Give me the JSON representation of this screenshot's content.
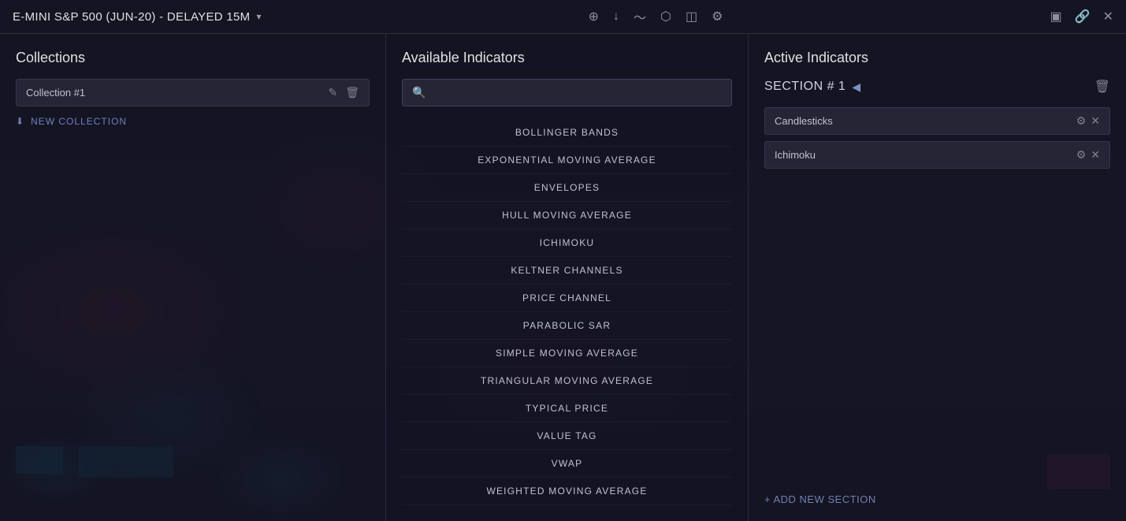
{
  "titleBar": {
    "title": "E-MINI S&P 500 (JUN-20) - DELAYED 15M",
    "dropdownIcon": "▾",
    "icons": [
      "⊕",
      "⬇",
      "〜",
      "⬡",
      "📅",
      "⚙"
    ],
    "actions": [
      "▣",
      "🔗",
      "✕"
    ]
  },
  "collections": {
    "title": "Collections",
    "item": {
      "name": "Collection #1",
      "editIcon": "✎",
      "deleteIcon": "🗑"
    },
    "newCollectionLabel": "NEW COLLECTION",
    "newCollectionIcon": "⬇"
  },
  "availableIndicators": {
    "title": "Available Indicators",
    "searchPlaceholder": "",
    "searchIcon": "🔍",
    "items": [
      "BOLLINGER BANDS",
      "EXPONENTIAL MOVING AVERAGE",
      "ENVELOPES",
      "HULL MOVING AVERAGE",
      "ICHIMOKU",
      "KELTNER CHANNELS",
      "PRICE CHANNEL",
      "PARABOLIC SAR",
      "SIMPLE MOVING AVERAGE",
      "TRIANGULAR MOVING AVERAGE",
      "TYPICAL PRICE",
      "VALUE TAG",
      "VWAP",
      "WEIGHTED MOVING AVERAGE"
    ]
  },
  "activeIndicators": {
    "title": "Active Indicators",
    "sectionTitle": "SECTION # 1",
    "sectionArrow": "◀",
    "deleteSectionIcon": "🗑",
    "items": [
      {
        "name": "Candlesticks",
        "settingsIcon": "⚙",
        "closeIcon": "✕"
      },
      {
        "name": "Ichimoku",
        "settingsIcon": "⚙",
        "closeIcon": "✕"
      }
    ],
    "addSectionLabel": "+ ADD NEW SECTION"
  }
}
